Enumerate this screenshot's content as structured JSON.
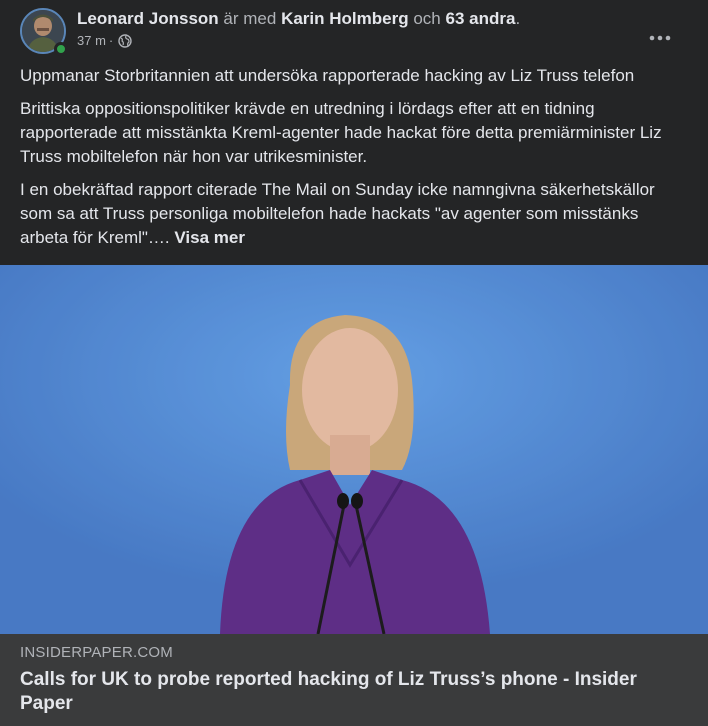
{
  "post": {
    "author": "Leonard Jonsson",
    "with_text": "är med",
    "tagged_person": "Karin Holmberg",
    "and_text": "och",
    "others": "63 andra",
    "period": ".",
    "time": "37 m",
    "dot": "·",
    "privacy_icon": "globe-icon",
    "paragraphs": [
      "Uppmanar Storbritannien att undersöka rapporterade hacking av Liz Truss telefon",
      "Brittiska oppositionspolitiker krävde en utredning i lördags efter att en tidning rapporterade att misstänkta Kreml-agenter hade hackat före detta premiärminister Liz Truss mobiltelefon när hon var utrikesminister.",
      "I en obekräftad rapport citerade The Mail on Sunday icke namngivna säkerhetskällor som sa att Truss personliga mobiltelefon hade hackats \"av agenter som misstänks arbeta för Kreml\"…."
    ],
    "see_more": "Visa mer"
  },
  "link_preview": {
    "domain": "INSIDERPAPER.COM",
    "title": "Calls for UK to probe reported hacking of Liz Truss’s phone - Insider Paper"
  },
  "colors": {
    "background": "#242526",
    "footer": "#3a3b3c",
    "online": "#31a24c"
  }
}
